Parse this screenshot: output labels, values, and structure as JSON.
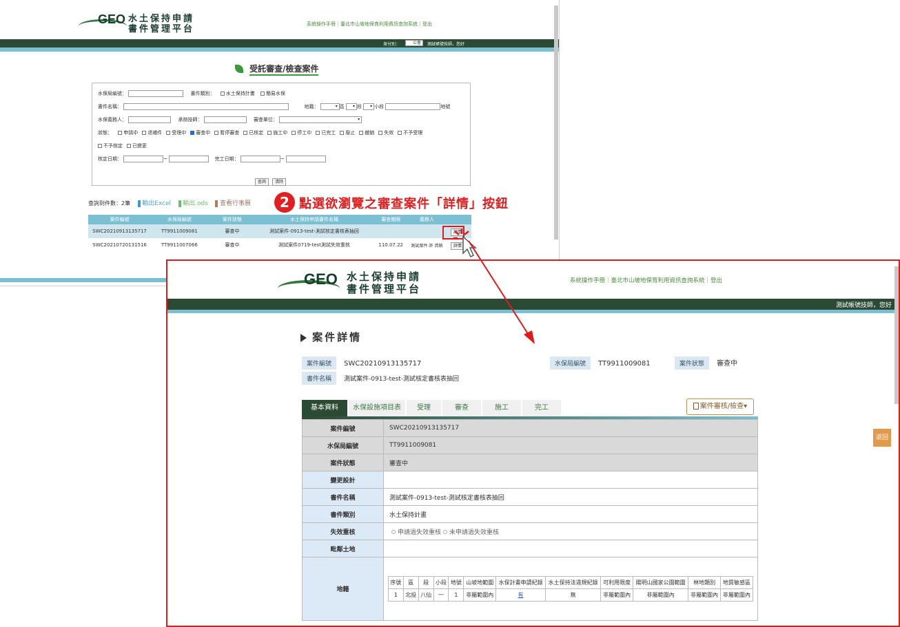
{
  "back": {
    "logo": {
      "geo": "GEO",
      "title_line1": "水土保持申請",
      "title_line2": "書件管理平台"
    },
    "toplinks": "系統操作手冊｜臺北市山坡地保育利用資訊查詢系統｜登出",
    "identity_label": "身分別：",
    "identity_value": "公會",
    "greeting": "測試帳號技師，您好",
    "page_title": "受託審查/檢查案件",
    "form": {
      "bureau_no": "水保局編號：",
      "doc_type": "書件類別：",
      "doc_type_opt1": "水土保持計畫",
      "doc_type_opt2": "簡易水保",
      "doc_name": "書件名稱：",
      "land": "地籍：",
      "district": "區",
      "section": "段",
      "subsection": "小段",
      "lot": "地號",
      "obligor": "水保義務人：",
      "engineer": "承辦技師：",
      "review_unit": "審查單位：",
      "status_label": "狀態：",
      "statuses": [
        "申請中",
        "退補件",
        "受理中",
        "審查中",
        "暫停審查",
        "已核定",
        "施工中",
        "停工中",
        "已完工",
        "廢止",
        "撤銷",
        "失效",
        "不予受理"
      ],
      "statuses_line2": [
        "不予核定",
        "已變更"
      ],
      "approve_date": "核定日期：",
      "complete_date": "完工日期：",
      "tilde": "~",
      "search_btn": "查詢",
      "clear_btn": "清除"
    },
    "result_count": "查詢到件數：2筆",
    "export_excel": "輸出Excel",
    "export_ods": "輸出.ods",
    "view_schedule": "查看行事曆",
    "table": {
      "headers": [
        "案件編號",
        "水保局編號",
        "案件狀態",
        "水土保持申請書件名稱",
        "審查期限",
        "義務人",
        ""
      ],
      "rows": [
        [
          "SWC20210913135717",
          "TT9911009081",
          "審查中",
          "測試案件-0913-test-測試核定書核表抽回",
          "",
          "",
          "詳情"
        ],
        [
          "SWC20210720131516",
          "TT9911007066",
          "審查中",
          "測試案件0719-test測試失效重核",
          "110.07.22",
          "測試案件-許\n資銷",
          "詳情"
        ]
      ]
    }
  },
  "annotation": {
    "step": "2",
    "text": "點選欲瀏覽之審查案件「詳情」按鈕"
  },
  "front": {
    "logo": {
      "geo": "GEO",
      "title_line1": "水土保持申請",
      "title_line2": "書件管理平台"
    },
    "toplinks": "系統操作手冊｜臺北市山坡地保育利用資訊查詢系統｜登出",
    "greeting": "測試帳號技師，您好",
    "section_title": "案件詳情",
    "summary": {
      "case_no_label": "案件編號",
      "case_no": "SWC20210913135717",
      "bureau_no_label": "水保局編號",
      "bureau_no": "TT9911009081",
      "status_label": "案件狀態",
      "status": "審查中",
      "doc_name_label": "書件名稱",
      "doc_name": "測試案件-0913-test-測試核定書核表抽回"
    },
    "tabs": [
      "基本資料",
      "水保設施項目表",
      "受理",
      "審查",
      "施工",
      "完工"
    ],
    "review_dropdown": "案件審核/檢查▾",
    "back_button": "返回",
    "details": [
      {
        "key": "案件編號",
        "value": "SWC20210913135717"
      },
      {
        "key": "水保局編號",
        "value": "TT9911009081"
      },
      {
        "key": "案件狀態",
        "value": "審查中"
      },
      {
        "key": "變更設計",
        "value": ""
      },
      {
        "key": "書件名稱",
        "value": "測試案件-0913-test-測試核定書核表抽回"
      },
      {
        "key": "書件類別",
        "value": "水土保持計畫"
      },
      {
        "key": "失效重核",
        "value": "",
        "radio1": "申請過失效重核",
        "radio2": "未申請過失效重核"
      },
      {
        "key": "毗鄰土地",
        "value": ""
      },
      {
        "key": "地籍",
        "value": ""
      }
    ],
    "land_table": {
      "headers": [
        "序號",
        "區",
        "段",
        "小段",
        "地號",
        "山坡地範圍",
        "水保計畫申請紀錄",
        "水土保持法違規紀錄",
        "可利用限度",
        "陽明山國家公園範圍",
        "林地類別",
        "地質敏感區"
      ],
      "row": [
        "1",
        "北投",
        "八仙",
        "一",
        "1",
        "非屬範圍內",
        "有",
        "無",
        "非屬範圍內",
        "非屬範圍內",
        "非屬範圍內",
        "非屬範圍內"
      ]
    }
  },
  "colors": {
    "accent_red": "#e01b1b",
    "dark_green": "#2a4a33",
    "light_blue": "#7bbfd2",
    "orange": "#e29a4a"
  }
}
